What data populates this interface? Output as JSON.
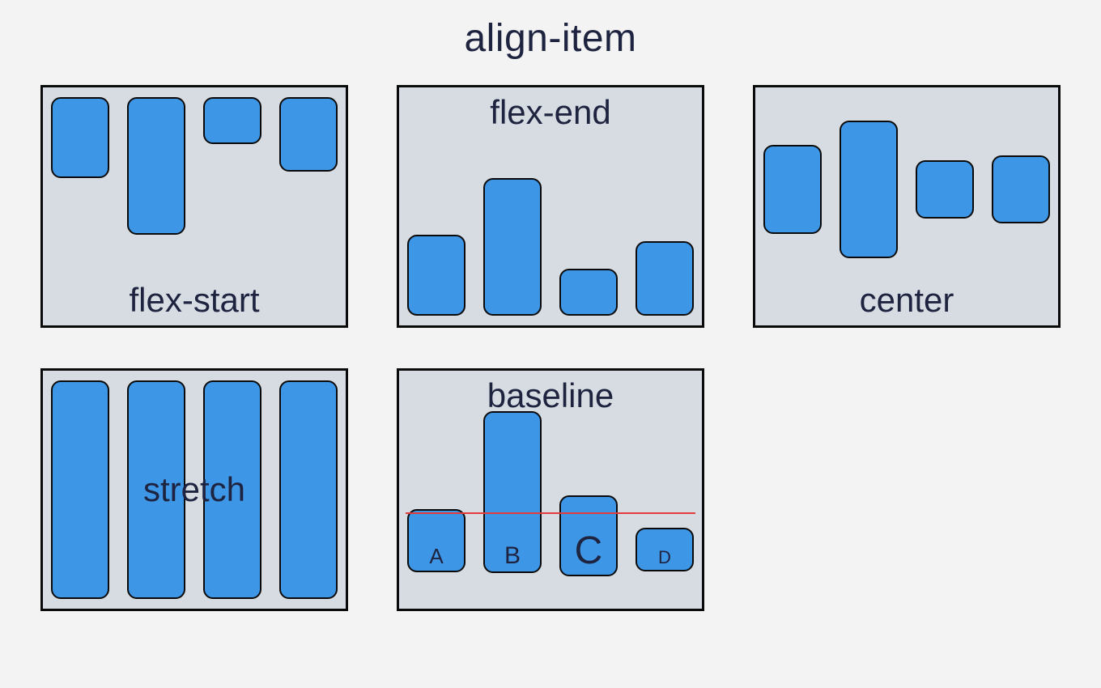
{
  "title": "align-item",
  "panels": {
    "flex_start": {
      "label": "flex-start"
    },
    "flex_end": {
      "label": "flex-end"
    },
    "center": {
      "label": "center"
    },
    "stretch": {
      "label": "stretch"
    },
    "baseline": {
      "label": "baseline",
      "items": [
        "A",
        "B",
        "C",
        "D"
      ]
    }
  }
}
